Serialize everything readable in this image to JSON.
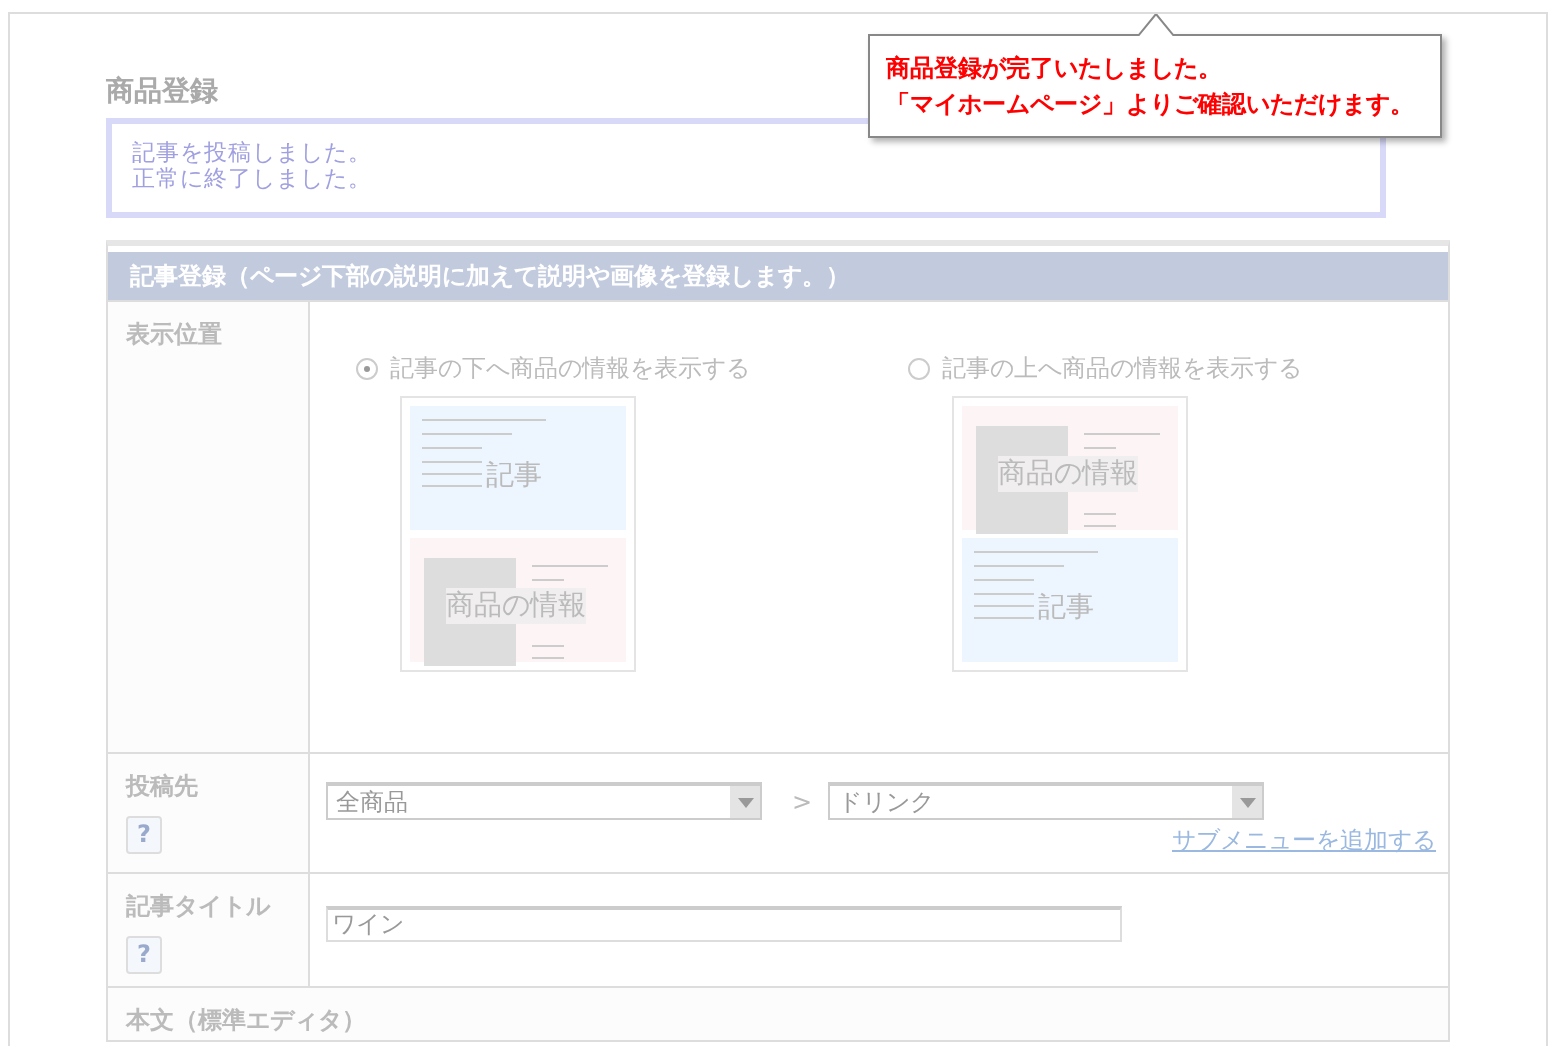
{
  "tooltip": {
    "lines": [
      "商品登録が完了いたしました。",
      "「マイホームページ」よりご確認いただけます。"
    ]
  },
  "page_title": "商品登録",
  "message": {
    "lines": [
      "記事を投稿しました。",
      "正常に終了しました。"
    ]
  },
  "section": {
    "title": "記事登録（ページ下部の説明に加えて説明や画像を登録します。）"
  },
  "rows": [
    {
      "kind": "position",
      "label": "表示位置",
      "options": [
        {
          "label": "記事の下へ商品の情報を表示する",
          "selected": true,
          "blocks": [
            {
              "kind": "article",
              "label": "記事"
            },
            {
              "kind": "product",
              "label": "商品の情報"
            }
          ]
        },
        {
          "label": "記事の上へ商品の情報を表示する",
          "selected": false,
          "blocks": [
            {
              "kind": "product",
              "label": "商品の情報"
            },
            {
              "kind": "article",
              "label": "記事"
            }
          ]
        }
      ]
    },
    {
      "kind": "category",
      "label": "投稿先",
      "help": "?",
      "selects": [
        "全商品",
        "ドリンク"
      ],
      "separator": ">",
      "link": "サブメニューを追加する"
    },
    {
      "kind": "title",
      "label": "記事タイトル",
      "help": "?",
      "value": "ワイン"
    },
    {
      "kind": "heading",
      "label": "本文（標準エディタ）"
    }
  ]
}
